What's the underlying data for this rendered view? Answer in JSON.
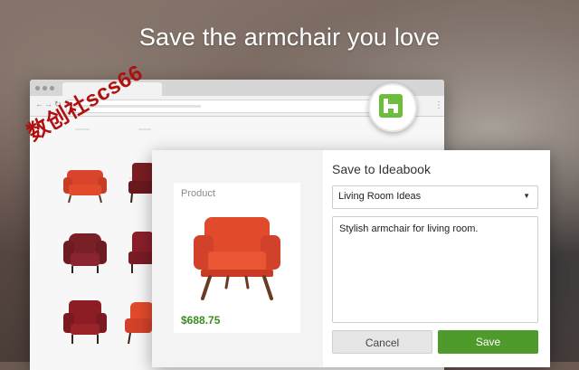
{
  "headline": "Save the armchair you love",
  "watermark": "数创社scs66",
  "browser": {
    "brand_icon": "houzz-logo-icon"
  },
  "dialog": {
    "title": "Save to Ideabook",
    "product": {
      "label": "Product",
      "price": "$688.75",
      "image": "red-armchair"
    },
    "ideabook_select": {
      "selected": "Living Room Ideas"
    },
    "comment": {
      "value": "Stylish armchair for living room."
    },
    "buttons": {
      "cancel": "Cancel",
      "save": "Save"
    }
  },
  "colors": {
    "save_green": "#4e9a2a",
    "price_green": "#3c8b1f",
    "houzz_green": "#6bbd3b",
    "chair_red": "#e24a2c"
  }
}
